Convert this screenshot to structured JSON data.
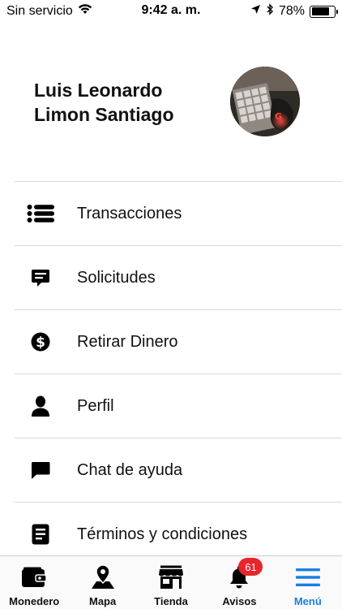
{
  "status_bar": {
    "carrier": "Sin servicio",
    "time": "9:42 a. m.",
    "battery": "78%",
    "battery_level": 0.78
  },
  "profile": {
    "name_line1": "Luis Leonardo",
    "name_line2": "Limon Santiago",
    "avatar": "keyboard-photo"
  },
  "menu": {
    "items": [
      {
        "label": "Transacciones",
        "icon": "list-icon"
      },
      {
        "label": "Solicitudes",
        "icon": "chat-bubble-text-icon"
      },
      {
        "label": "Retirar Dinero",
        "icon": "dollar-circle-icon"
      },
      {
        "label": "Perfil",
        "icon": "person-icon"
      },
      {
        "label": "Chat de ayuda",
        "icon": "chat-bubble-icon"
      },
      {
        "label": "Términos y condiciones",
        "icon": "document-icon"
      }
    ]
  },
  "tabbar": {
    "tabs": [
      {
        "label": "Monedero",
        "icon": "wallet-icon"
      },
      {
        "label": "Mapa",
        "icon": "map-pin-icon"
      },
      {
        "label": "Tienda",
        "icon": "store-icon"
      },
      {
        "label": "Avisos",
        "icon": "bell-icon",
        "badge": "61"
      },
      {
        "label": "Menú",
        "icon": "hamburger-icon",
        "active": true
      }
    ]
  },
  "colors": {
    "accent": "#1a7ee6",
    "badge": "#e8252b",
    "divider": "#d9d9d9"
  }
}
